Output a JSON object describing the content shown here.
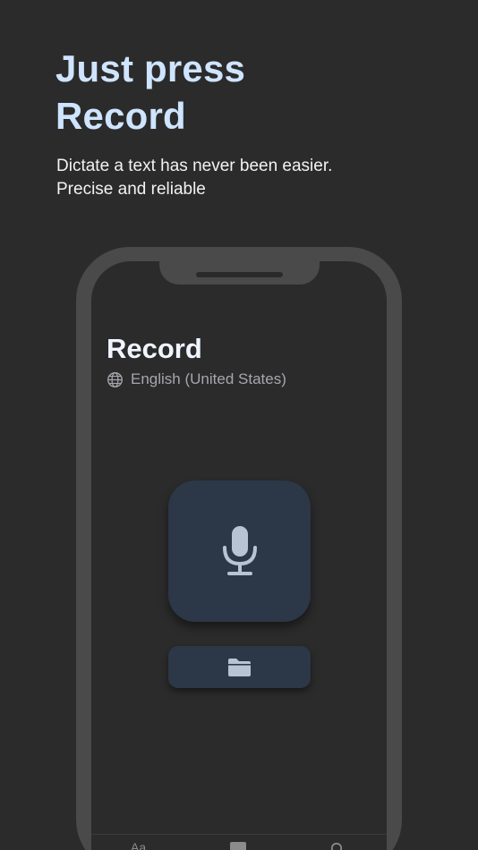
{
  "headline": {
    "line1": "Just press",
    "line2": "Record"
  },
  "subtitle": {
    "line1": "Dictate a text has never been easier.",
    "line2": "Precise and reliable"
  },
  "app": {
    "title": "Record",
    "language": "English (United States)",
    "tab_text_label": "Aa"
  },
  "icons": {
    "language": "globe-icon",
    "record": "microphone-icon",
    "files": "folder-icon"
  },
  "colors": {
    "background": "#2b2b2b",
    "headline": "#cfe4ff",
    "button": "#2c3747",
    "icon": "#b8c4d4"
  }
}
